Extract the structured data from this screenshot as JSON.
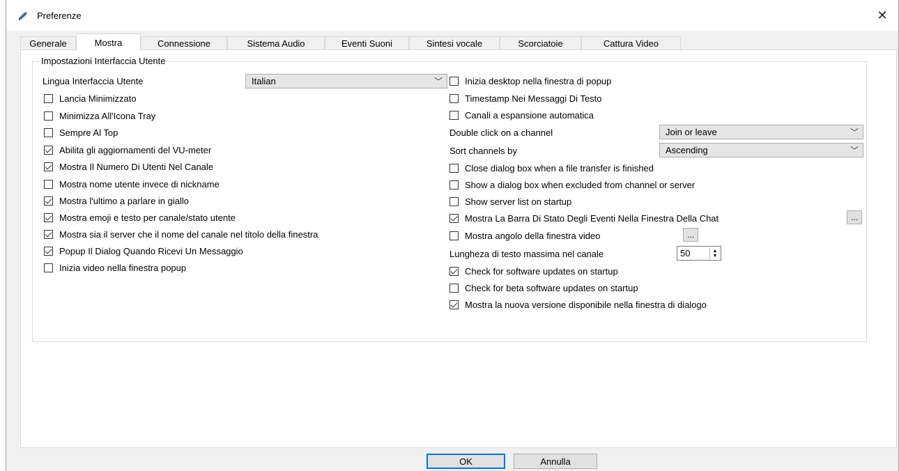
{
  "window": {
    "title": "Preferenze",
    "close_glyph": "✕"
  },
  "tabs": [
    {
      "label": "Generale"
    },
    {
      "label": "Mostra",
      "active": true
    },
    {
      "label": "Connessione"
    },
    {
      "label": "Sistema Audio"
    },
    {
      "label": "Eventi Suoni"
    },
    {
      "label": "Sintesi vocale"
    },
    {
      "label": "Scorciatoie"
    },
    {
      "label": "Cattura Video"
    }
  ],
  "group": {
    "title": "Impostazioni Interfaccia Utente",
    "language_label": "Lingua Interfaccia Utente",
    "language_value": "Italian"
  },
  "left_options": [
    {
      "label": "Lancia Minimizzato",
      "checked": false
    },
    {
      "label": "Minimizza All'Icona Tray",
      "checked": false
    },
    {
      "label": "Sempre Al Top",
      "checked": false
    },
    {
      "label": "Abilita gli aggiornamenti del VU-meter",
      "checked": true
    },
    {
      "label": "Mostra Il Numero Di Utenti Nel Canale",
      "checked": true
    },
    {
      "label": "Mostra nome utente invece di nickname",
      "checked": false
    },
    {
      "label": "Mostra l'ultimo a parlare in giallo",
      "checked": true
    },
    {
      "label": "Mostra emoji e testo per canale/stato utente",
      "checked": true
    },
    {
      "label": "Mostra sia il server che il nome del canale nel titolo della finestra",
      "checked": true
    },
    {
      "label": "Popup Il Dialog Quando Ricevi Un Messaggio",
      "checked": true
    },
    {
      "label": "Inizia video nella finestra popup",
      "checked": false
    }
  ],
  "right_top_options": [
    {
      "label": "Inizia desktop nella finestra di popup",
      "checked": false
    },
    {
      "label": "Timestamp Nei Messaggi Di Testo",
      "checked": false
    },
    {
      "label": "Canali a espansione automatica",
      "checked": false
    }
  ],
  "double_click": {
    "label": "Double click on a channel",
    "value": "Join or leave"
  },
  "sort_channels": {
    "label": "Sort channels by",
    "value": "Ascending"
  },
  "right_mid_options": [
    {
      "label": "Close dialog box when a file transfer is finished",
      "checked": false
    },
    {
      "label": "Show a dialog box when excluded from channel or server",
      "checked": false
    },
    {
      "label": "Show server list on startup",
      "checked": false
    },
    {
      "label": "Mostra La Barra Di Stato Degli Eventi Nella Finestra Della Chat",
      "checked": true
    },
    {
      "label": "Mostra angolo della finestra video",
      "checked": false
    }
  ],
  "dots_label": "...",
  "max_text": {
    "label": "Lungheza di testo massima nel canale",
    "value": "50"
  },
  "right_bottom_options": [
    {
      "label": "Check for software updates on startup",
      "checked": true
    },
    {
      "label": "Check for beta software updates on startup",
      "checked": false
    },
    {
      "label": "Mostra la nuova versione disponibile nella finestra di dialogo",
      "checked": true
    }
  ],
  "buttons": {
    "ok": "OK",
    "cancel": "Annulla"
  }
}
